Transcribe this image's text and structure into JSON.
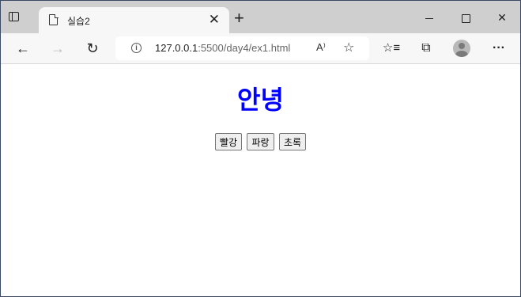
{
  "browser": {
    "tab": {
      "title": "실습2",
      "close_glyph": "✕"
    },
    "new_tab_glyph": "+",
    "window_controls": {
      "close_glyph": "✕"
    },
    "toolbar": {
      "back_glyph": "←",
      "forward_glyph": "→",
      "refresh_glyph": "↻",
      "url_host": "127.0.0.1",
      "url_rest": ":5500/day4/ex1.html",
      "read_aloud_glyph": "A⁾",
      "favorite_glyph": "☆",
      "favorites_glyph": "☆≡",
      "collections_glyph": "⧉",
      "menu_glyph": "···"
    }
  },
  "page": {
    "heading": "안녕",
    "heading_color": "#0000ff",
    "buttons": [
      {
        "label": "빨강"
      },
      {
        "label": "파랑"
      },
      {
        "label": "초록"
      }
    ]
  }
}
